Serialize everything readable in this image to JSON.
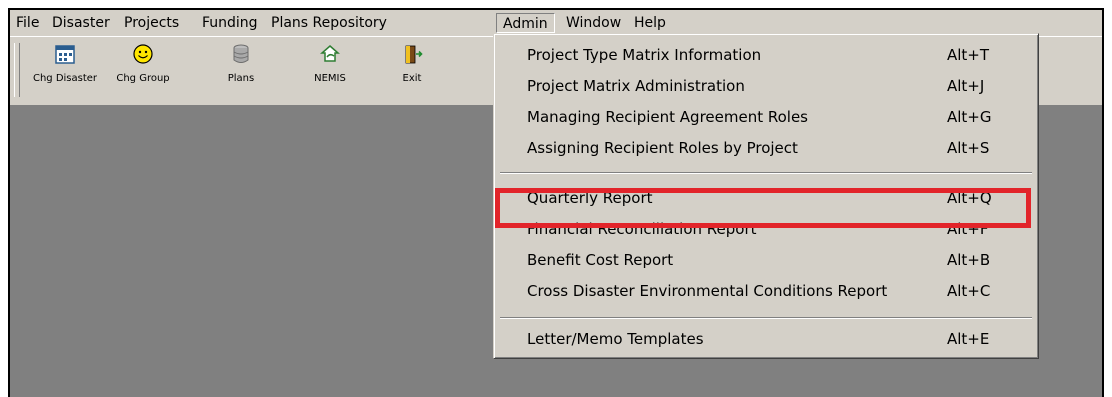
{
  "menubar": {
    "items": [
      "File",
      "Disaster",
      "Projects",
      "Funding",
      "Plans Repository",
      "Admin",
      "Window",
      "Help"
    ]
  },
  "toolbar": {
    "buttons": [
      {
        "label": "Chg Disaster",
        "icon": "calendar-icon"
      },
      {
        "label": "Chg Group",
        "icon": "smiley-icon"
      },
      {
        "label": "Plans",
        "icon": "database-icon"
      },
      {
        "label": "NEMIS",
        "icon": "nemis-icon"
      },
      {
        "label": "Exit",
        "icon": "exit-door-icon"
      }
    ]
  },
  "admin_menu": {
    "items": [
      {
        "label": "Project Type Matrix Information",
        "shortcut": "Alt+T"
      },
      {
        "label": "Project Matrix Administration",
        "shortcut": "Alt+J"
      },
      {
        "label": "Managing Recipient Agreement Roles",
        "shortcut": "Alt+G"
      },
      {
        "label": "Assigning Recipient Roles by Project",
        "shortcut": "Alt+S"
      },
      {
        "label": "Quarterly Report",
        "shortcut": "Alt+Q"
      },
      {
        "label": "Financial Reconciliation Report",
        "shortcut": "Alt+F"
      },
      {
        "label": "Benefit Cost Report",
        "shortcut": "Alt+B"
      },
      {
        "label": "Cross Disaster Environmental Conditions Report",
        "shortcut": "Alt+C"
      },
      {
        "label": "Letter/Memo Templates",
        "shortcut": "Alt+E"
      }
    ]
  },
  "colors": {
    "highlight": "#e2242a",
    "workspace": "#808080",
    "chrome": "#d4d0c8"
  }
}
